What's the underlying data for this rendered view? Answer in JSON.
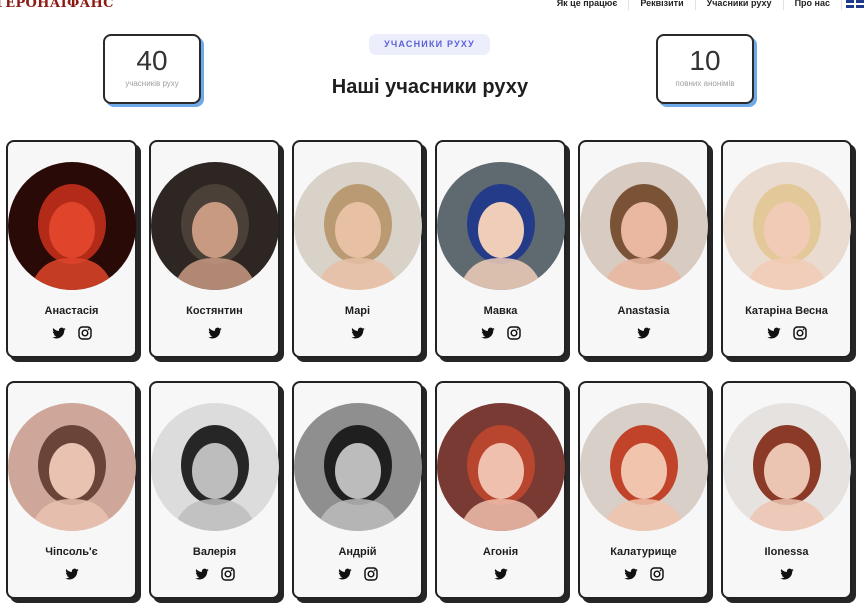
{
  "header": {
    "logo": "ГЕРОНАІФАНС",
    "nav": [
      {
        "label": "Як це працює"
      },
      {
        "label": "Реквізити"
      },
      {
        "label": "Учасники руху"
      },
      {
        "label": "Про нас"
      }
    ],
    "language_flag": "uk-flag-icon"
  },
  "stats": {
    "left": {
      "value": "40",
      "label": "учасників руху"
    },
    "right": {
      "value": "10",
      "label": "повних анонімів"
    }
  },
  "hero": {
    "badge": "УЧАСНИКИ РУХУ",
    "title_plain": "Наші",
    "title_highlight": "учасники руху"
  },
  "colors": {
    "accent_purple": "#5b61d9",
    "highlight_green": "#6bd36b",
    "stat_shadow_blue": "#6fa9e8",
    "logo_red": "#8c1a14"
  },
  "members": [
    {
      "name": "Анастасія",
      "socials": [
        "twitter",
        "instagram"
      ],
      "photo": {
        "bg": "#2a0a06",
        "face": "#e0452c",
        "hair": "#b32a18"
      }
    },
    {
      "name": "Костянтин",
      "socials": [
        "twitter"
      ],
      "photo": {
        "bg": "#2e2622",
        "face": "#c89a82",
        "hair": "#4a4038"
      }
    },
    {
      "name": "Марі",
      "socials": [
        "twitter"
      ],
      "photo": {
        "bg": "#d9d2c8",
        "face": "#e8c0a4",
        "hair": "#b99a72"
      }
    },
    {
      "name": "Мавка",
      "socials": [
        "twitter",
        "instagram"
      ],
      "photo": {
        "bg": "#5e6a70",
        "face": "#f0cdb9",
        "hair": "#243b8a"
      }
    },
    {
      "name": "Anastasia",
      "socials": [
        "twitter"
      ],
      "photo": {
        "bg": "#d7cbc2",
        "face": "#eab7a0",
        "hair": "#7a5236"
      }
    },
    {
      "name": "Катаріна Весна",
      "socials": [
        "twitter",
        "instagram"
      ],
      "photo": {
        "bg": "#eadbd0",
        "face": "#f2cbb6",
        "hair": "#e3c89a"
      }
    },
    {
      "name": "Чіпсоль'є",
      "socials": [
        "twitter"
      ],
      "photo": {
        "bg": "#cfa79a",
        "face": "#e9c2b2",
        "hair": "#6a4438"
      }
    },
    {
      "name": "Валерія",
      "socials": [
        "twitter",
        "instagram"
      ],
      "photo": {
        "bg": "#dcdcdc",
        "face": "#bdbdbd",
        "hair": "#262626"
      }
    },
    {
      "name": "Андрій",
      "socials": [
        "twitter",
        "instagram"
      ],
      "photo": {
        "bg": "#8f8f8f",
        "face": "#bcbcbc",
        "hair": "#1f1f1f"
      }
    },
    {
      "name": "Агонія",
      "socials": [
        "twitter"
      ],
      "photo": {
        "bg": "#7a3a34",
        "face": "#f0c0ae",
        "hair": "#b8452e"
      }
    },
    {
      "name": "Калатурище",
      "socials": [
        "twitter",
        "instagram"
      ],
      "photo": {
        "bg": "#d8cfc9",
        "face": "#f1c4ad",
        "hair": "#c0432a"
      }
    },
    {
      "name": "Ilonessa",
      "socials": [
        "twitter"
      ],
      "photo": {
        "bg": "#e6e2df",
        "face": "#ecc4b2",
        "hair": "#8a3a26"
      }
    }
  ]
}
